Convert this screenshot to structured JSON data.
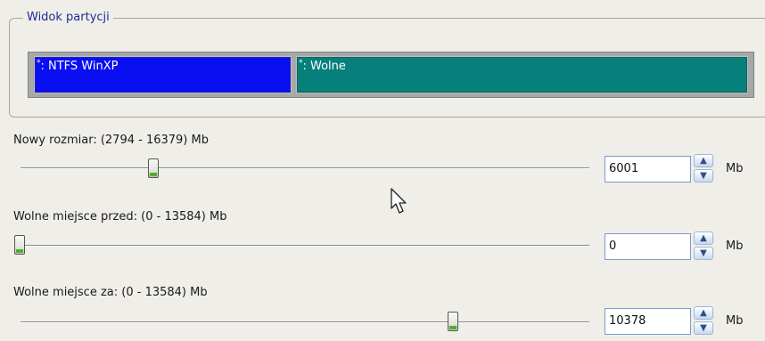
{
  "group": {
    "title": "Widok partycji"
  },
  "partitions": [
    {
      "star": "*",
      "label": ": NTFS WinXP",
      "color": "#0a0ff2"
    },
    {
      "star": "*",
      "label": ": Wolne",
      "color": "#077f7b"
    }
  ],
  "controls": {
    "size": {
      "label": "Nowy rozmiar: (2794 - 16379) Mb",
      "value": "6001",
      "unit": "Mb",
      "slider_min": 2794,
      "slider_max": 16379,
      "slider_value": 6001
    },
    "free_before": {
      "label": "Wolne miejsce przed: (0 - 13584) Mb",
      "value": "0",
      "unit": "Mb",
      "slider_min": 0,
      "slider_max": 13584,
      "slider_value": 0
    },
    "free_after": {
      "label": "Wolne miejsce za: (0 - 13584) Mb",
      "value": "10378",
      "unit": "Mb",
      "slider_min": 0,
      "slider_max": 13584,
      "slider_value": 10378
    }
  },
  "icons": {
    "spin_up": "chevron-up-icon",
    "spin_down": "chevron-down-icon",
    "cursor": "mouse-pointer-icon"
  }
}
